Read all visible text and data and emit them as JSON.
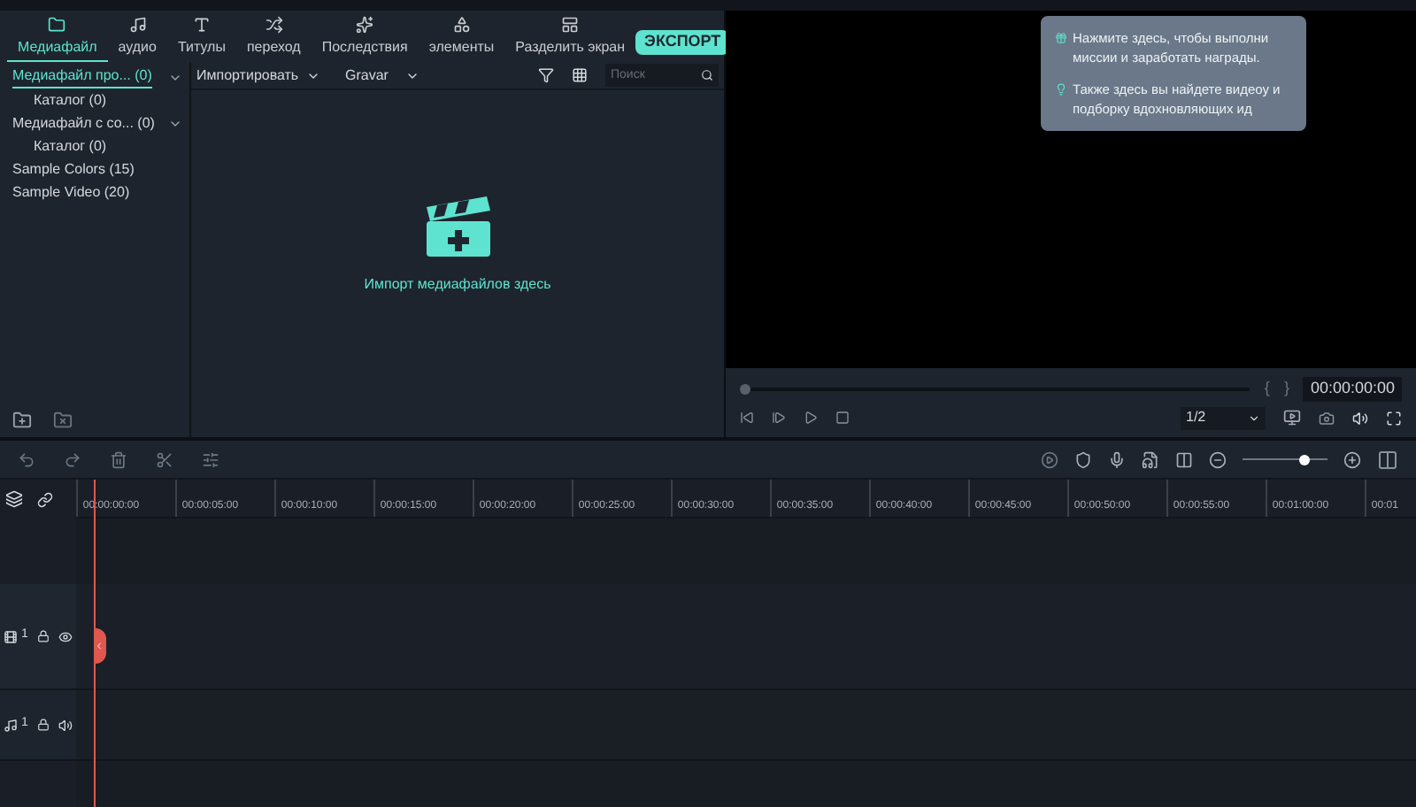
{
  "tabs": [
    {
      "label": "Медиафайл",
      "selected": true
    },
    {
      "label": "аудио",
      "selected": false
    },
    {
      "label": "Титулы",
      "selected": false
    },
    {
      "label": "переход",
      "selected": false
    },
    {
      "label": "Последствия",
      "selected": false
    },
    {
      "label": "элементы",
      "selected": false
    },
    {
      "label": "Разделить экран",
      "selected": false
    }
  ],
  "export_button": "ЭКСПОРТ",
  "sidebar": {
    "items": [
      {
        "label": "Медиафайл про... (0)",
        "selected": true,
        "expanded": true,
        "children": [
          {
            "label": "Каталог (0)",
            "selected": false
          }
        ]
      },
      {
        "label": "Медиафайл с со... (0)",
        "selected": false,
        "expanded": true,
        "children": [
          {
            "label": "Каталог (0)",
            "selected": false
          }
        ]
      },
      {
        "label": "Sample Colors (15)",
        "selected": false
      },
      {
        "label": "Sample Video (20)",
        "selected": false
      }
    ]
  },
  "media_toolbar": {
    "import_dropdown": "Импортировать",
    "record_dropdown": "Gravar",
    "search": {
      "placeholder": "Поиск"
    }
  },
  "media_empty": {
    "text": "Импорт медиафайлов здесь"
  },
  "tooltip": {
    "lines": [
      "Нажмите здесь, чтобы выполни миссии и заработать награды.",
      "Также здесь вы найдете видеоу и подборку вдохновляющих ид"
    ]
  },
  "preview": {
    "level": 0,
    "mark_in": "{",
    "mark_out": "}",
    "timecode": "00:00:00:00",
    "quality": "1/2"
  },
  "zoom_slider": {
    "level": 0.72
  },
  "timeline": {
    "ticks": [
      "00:00:00:00",
      "00:00:05:00",
      "00:00:10:00",
      "00:00:15:00",
      "00:00:20:00",
      "00:00:25:00",
      "00:00:30:00",
      "00:00:35:00",
      "00:00:40:00",
      "00:00:45:00",
      "00:00:50:00",
      "00:00:55:00",
      "00:01:00:00",
      "00:01"
    ],
    "tracks": [
      {
        "kind": "video",
        "number": "1"
      },
      {
        "kind": "audio",
        "number": "1"
      }
    ]
  }
}
